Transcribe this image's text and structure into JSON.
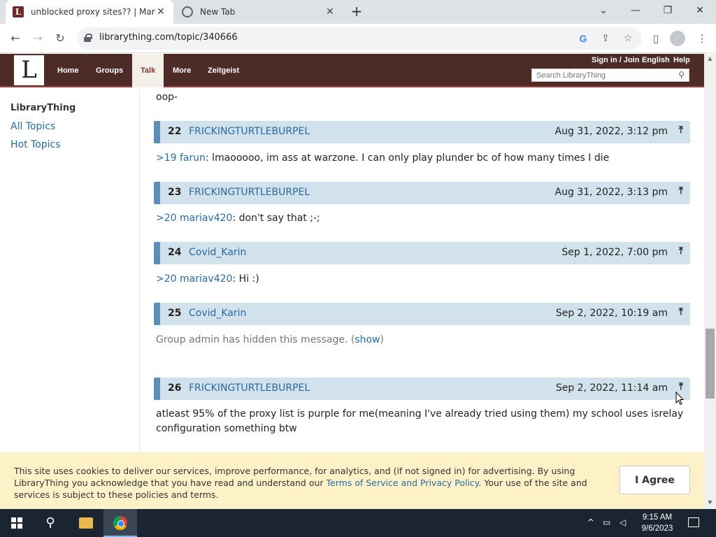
{
  "browser": {
    "tabs": [
      {
        "title": "unblocked proxy sites?? | Manga",
        "active": true
      },
      {
        "title": "New Tab",
        "active": false
      }
    ],
    "url": "librarything.com/topic/340666"
  },
  "site": {
    "logo_letter": "L",
    "nav": [
      "Home",
      "Groups",
      "Talk",
      "More",
      "Zeitgeist"
    ],
    "toplinks": {
      "signin": "Sign in / Join",
      "language": "English",
      "help": "Help"
    },
    "search_placeholder": "Search LibraryThing"
  },
  "sidebar": {
    "title": "LibraryThing",
    "links": [
      "All Topics",
      "Hot Topics"
    ]
  },
  "thread": {
    "leading_text": "oop-",
    "posts": [
      {
        "num": "22",
        "author": "FRICKINGTURTLEBURPEL",
        "date": "Aug 31, 2022, 3:12 pm",
        "ref": ">19 farun",
        "body": ": lmaooooo, im ass at warzone. I can only play plunder bc of how many times I die"
      },
      {
        "num": "23",
        "author": "FRICKINGTURTLEBURPEL",
        "date": "Aug 31, 2022, 3:13 pm",
        "ref": ">20 mariav420",
        "body": ": don't say that ;-;"
      },
      {
        "num": "24",
        "author": "Covid_Karin",
        "date": "Sep 1, 2022, 7:00 pm",
        "ref": ">20 mariav420",
        "body": ": Hi :)"
      },
      {
        "num": "25",
        "author": "Covid_Karin",
        "date": "Sep 2, 2022, 10:19 am",
        "hidden_text": "Group admin has hidden this message.",
        "show_label": "show"
      },
      {
        "num": "26",
        "author": "FRICKINGTURTLEBURPEL",
        "date": "Sep 2, 2022, 11:14 am",
        "body": "atleast 95% of the proxy list is purple for me(meaning I've already tried using them) my school uses isrelay configuration something btw"
      }
    ]
  },
  "cookie": {
    "text_before": "This site uses cookies to deliver our services, improve performance, for analytics, and (if not signed in) for advertising. By using LibraryThing you acknowledge that you have read and understand our ",
    "tos_link": "Terms of Service and Privacy Policy",
    "text_after": ". Your use of the site and services is subject to these policies and terms.",
    "agree_label": "I Agree"
  },
  "taskbar": {
    "time": "9:15 AM",
    "date": "9/6/2023"
  }
}
